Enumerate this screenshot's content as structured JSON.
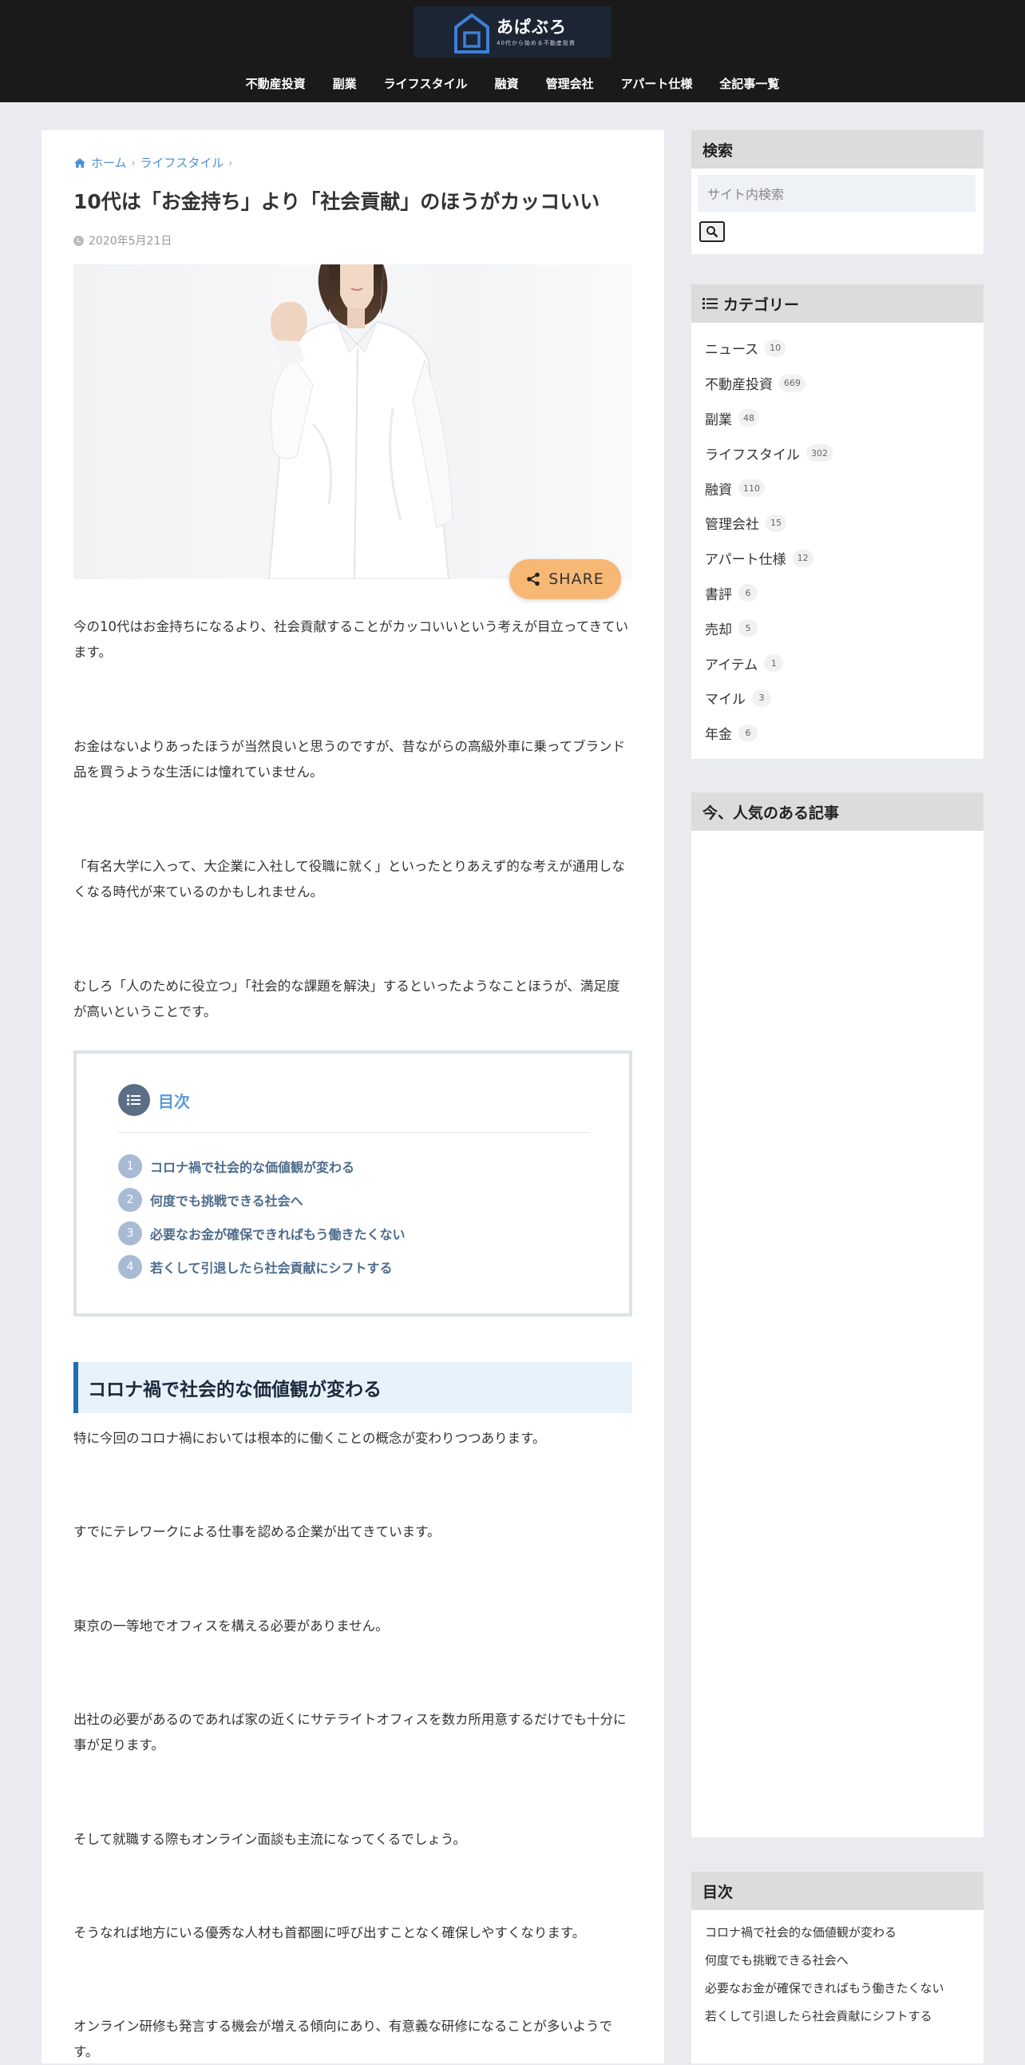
{
  "header": {
    "logo_text": "あぱぶろ",
    "logo_sub": "40代から始める不動産投資",
    "nav": [
      "不動産投資",
      "副業",
      "ライフスタイル",
      "融資",
      "管理会社",
      "アパート仕様",
      "全記事一覧"
    ]
  },
  "article": {
    "breadcrumb": [
      "ホーム",
      "ライフスタイル"
    ],
    "title": "10代は「お金持ち」より「社会貢献」のほうがカッコいい",
    "date": "2020年5月21日",
    "share_label": "SHARE",
    "intro_paragraphs": [
      "今の10代はお金持ちになるより、社会貢献することがカッコいいという考えが目立ってきています。",
      "お金はないよりあったほうが当然良いと思うのですが、昔ながらの高級外車に乗ってブランド品を買うような生活には憧れていません。",
      "「有名大学に入って、大企業に入社して役職に就く」といったとりあえず的な考えが通用しなくなる時代が来ているのかもしれません。",
      "むしろ「人のために役立つ」「社会的な課題を解決」するといったようなことほうが、満足度が高いということです。"
    ],
    "toc": {
      "title": "目次",
      "items": [
        {
          "num": "1",
          "label": "コロナ禍で社会的な価値観が変わる"
        },
        {
          "num": "2",
          "label": "何度でも挑戦できる社会へ"
        },
        {
          "num": "3",
          "label": "必要なお金が確保できればもう働きたくない"
        },
        {
          "num": "4",
          "label": "若くして引退したら社会貢献にシフトする"
        }
      ]
    },
    "section1": {
      "heading": "コロナ禍で社会的な価値観が変わる",
      "paragraphs": [
        "特に今回のコロナ禍においては根本的に働くことの概念が変わりつつあります。",
        "すでにテレワークによる仕事を認める企業が出てきています。",
        "東京の一等地でオフィスを構える必要がありません。",
        "出社の必要があるのであれば家の近くにサテライトオフィスを数カ所用意するだけでも十分に事が足ります。",
        "そして就職する際もオンライン面談も主流になってくるでしょう。",
        "そうなれば地方にいる優秀な人材も首都圏に呼び出すことなく確保しやすくなります。",
        "オンライン研修も発言する機会が増える傾向にあり、有意義な研修になることが多いようです。"
      ]
    }
  },
  "sidebar": {
    "search": {
      "title": "検索",
      "placeholder": "サイト内検索"
    },
    "categories": {
      "title": "カテゴリー",
      "items": [
        {
          "label": "ニュース",
          "count": "10"
        },
        {
          "label": "不動産投資",
          "count": "669"
        },
        {
          "label": "副業",
          "count": "48"
        },
        {
          "label": "ライフスタイル",
          "count": "302"
        },
        {
          "label": "融資",
          "count": "110"
        },
        {
          "label": "管理会社",
          "count": "15"
        },
        {
          "label": "アパート仕様",
          "count": "12"
        },
        {
          "label": "書評",
          "count": "6"
        },
        {
          "label": "売却",
          "count": "5"
        },
        {
          "label": "アイテム",
          "count": "1"
        },
        {
          "label": "マイル",
          "count": "3"
        },
        {
          "label": "年金",
          "count": "6"
        }
      ]
    },
    "popular": {
      "title": "今、人気のある記事"
    },
    "toc": {
      "title": "目次",
      "items": [
        "コロナ禍で社会的な価値観が変わる",
        "何度でも挑戦できる社会へ",
        "必要なお金が確保できればもう働きたくない",
        "若くして引退したら社会貢献にシフトする"
      ]
    }
  },
  "colors": {
    "header_bg": "#1a1a1a",
    "link_blue": "#4a90d9",
    "share_orange": "#f7b875",
    "h2_border": "#1f6db3",
    "toc_num_bg": "#a8bbd4"
  }
}
